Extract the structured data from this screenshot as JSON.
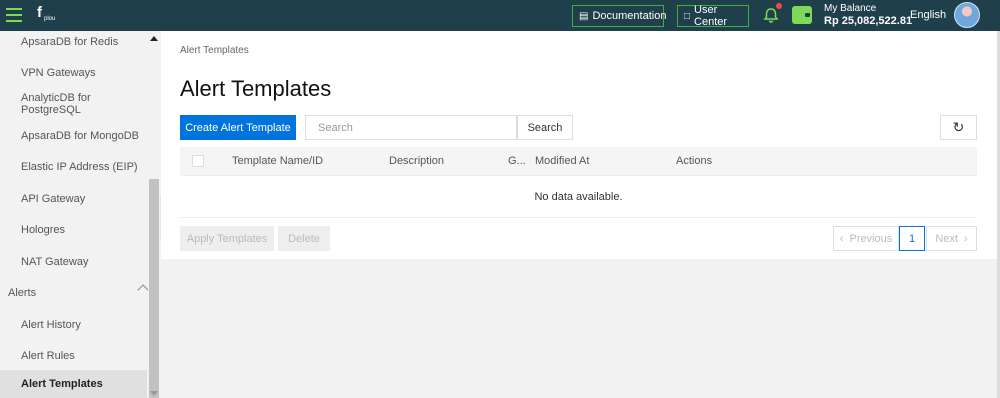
{
  "topbar": {
    "logo_text": "plou",
    "documentation_label": "Documentation",
    "user_center_label": "User Center",
    "balance_label": "My Balance",
    "balance_amount": "Rp 25,082,522.81",
    "language": "English"
  },
  "sidebar": {
    "items": [
      {
        "label": "ApsaraDB for Redis"
      },
      {
        "label": "VPN Gateways"
      },
      {
        "label": "AnalyticDB for PostgreSQL"
      },
      {
        "label": "ApsaraDB for MongoDB"
      },
      {
        "label": "Elastic IP Address (EIP)"
      },
      {
        "label": "API Gateway"
      },
      {
        "label": "Hologres"
      },
      {
        "label": "NAT Gateway"
      },
      {
        "label": "Alerts"
      },
      {
        "label": "Alert History"
      },
      {
        "label": "Alert Rules"
      },
      {
        "label": "Alert Templates"
      }
    ]
  },
  "main": {
    "breadcrumb": "Alert Templates",
    "title": "Alert Templates",
    "create_button": "Create Alert Template",
    "search_placeholder": "Search",
    "search_button": "Search",
    "table": {
      "columns": [
        "Template Name/ID",
        "Description",
        "G...",
        "Modified At",
        "Actions"
      ],
      "empty_text": "No data available."
    },
    "apply_button": "Apply Templates",
    "delete_button": "Delete",
    "pagination": {
      "prev": "Previous",
      "current_page": "1",
      "next": "Next"
    }
  },
  "colors": {
    "topbar": "#1f3f4b",
    "accent_green": "#7ed957",
    "primary_blue": "#0073dd"
  }
}
